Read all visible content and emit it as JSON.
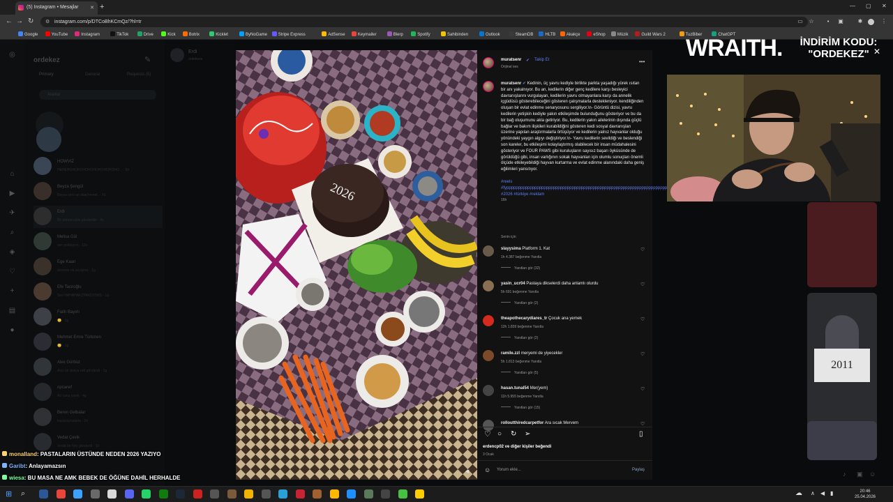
{
  "browser": {
    "tab_title": "(5) Instagram • Mesajlar",
    "url": "instagram.com/p/DTCoBhKCmQz/?hl=tr",
    "bookmarks": [
      "Google",
      "YouTube",
      "Instagram",
      "TikTok",
      "Drive",
      "Kick",
      "Botrix",
      "Kicklet",
      "ByNoGame",
      "Stripe Express",
      "AdSense",
      "Keymailer",
      "Blerp",
      "Spotify",
      "Sahibinden",
      "Outlook",
      "SteamDB",
      "HLTB",
      "Akakçe",
      "eShop",
      "Müzik",
      "Guild Wars 2",
      "TuzBiber",
      "ChatGPT"
    ]
  },
  "inbox": {
    "username": "ordekez",
    "tabs": [
      "Primary",
      "General",
      "Requests (6)"
    ],
    "search_placeholder": "Arama",
    "conversations": [
      {
        "name": "HOWVIZ",
        "msg": "HEHEHOHOHOHOHOHOHOHOHOHO... · 3d"
      },
      {
        "name": "Beyza Şengül",
        "msg": "Beyza sent an attachment. · 7d"
      },
      {
        "name": "Erdi",
        "msg": "Bir dönem ekle gönderdin · 4s"
      },
      {
        "name": "Melisa Gül",
        "msg": "sen yoldaşsın · 13s"
      },
      {
        "name": "Ege Kaan",
        "msg": "anneniz ne sevişiniz · 1g"
      },
      {
        "name": "Efe Taciroğlu",
        "msg": "Sen HAHAHAKZPAKDJSMS · 1g"
      },
      {
        "name": "Fatih Bayırlı",
        "msg": "😊 · 1g"
      },
      {
        "name": "Mehmet Emre Türkmen",
        "msg": "😊 · 1g"
      },
      {
        "name": "Alex Gürbüz",
        "msg": "Alex bir dosya ekli gönderdi · 1g"
      },
      {
        "name": "npcarwf",
        "msg": "Ah cana yanık · 4g"
      },
      {
        "name": "Beren Gelbalar",
        "msg": "kapanışmalarla · 1h"
      },
      {
        "name": "Vedat Çevik",
        "msg": "Vedat bir foto gönderdi · 1h"
      }
    ],
    "chat_header": "Erdi",
    "chat_sub": "ordekeze"
  },
  "post": {
    "author": "muratsenr",
    "follow": "Takip Et",
    "audio": "Orijinal ses",
    "caption": "Kedinin, üç yavru kediyle birlikte parkta yaşadığı yürek ısıtan bir anı yakalnıyor. Bu an, kedilerin diğer genç kedilere karşı besleyici davranışlarını vurgulayan, kedilerin yavru olmayanlara karşı da annelik içgüdüsü gösterebileceğini gösteren çalışmalarla destekleniyor. kendiliğinden oluşan bir evlat edinme senaryosunu sergiliyor.\\n- Görüntü dizisi, yavru kedilerin yetişkin kediyle yakın etkileşimde bulunduğunu gösteriyor ve bu da bir bağ oluşumunu akla getiriyor. Bu, kedilerin yakın ailelerinin dışında güçlü bağlar ve bakım ilişkileri kurabildiğini gösteren kedi sosyal davranışları üzerine yapılan araştırmalarla örtüşüyor ve kedilerin yalnız hayvanlar olduğu yönündeki yaygın algıyı değiştiriyor.\\n- Yavru kedilerin sevildiği ve beslendiği son kareler, bu etkileşimi kolaylaştırmış olabilecek bir insan müdahalesini gösteriyor ve FOUR PAWS gibi kuruluşların sayısız başarı öyküsünde de görüldüğü gibi, insan varlığının sokak hayvanları için olumlu sonuçları önemli ölçüde etkileyebildiği hayvan kurtarma ve evlat edinme alanındaki daha geniş eğilimleri yansıtıyor.",
    "hashtags": "#reels #fyppppppppppppppppppppppppppppppppppppppppppppppppppppppppppppppppppppppppppppp #2026 #türkiye #reklam",
    "time": "16h",
    "for_you": "Senin için",
    "comments": [
      {
        "user": "slayysima",
        "text": "Platform 1. Kat",
        "meta": "1h   4.387 beğenme   Yanıtla",
        "replies": "Yanıtları gör (32)"
      },
      {
        "user": "yasin_ucr04",
        "text": "Pastaya dikselerdi daha anlamlı olurdu",
        "meta": "5h   691 beğenme   Yanıtla",
        "replies": "Yanıtları gör (2)"
      },
      {
        "user": "theapothecarydiares_tr",
        "text": "Çocuk ana yemek",
        "meta": "12h   1.839 beğenme   Yanıtla",
        "replies": "Yanıtları gör (2)"
      },
      {
        "user": "ramile.zzl",
        "text": "meryemi de yiyecekler",
        "meta": "5h   1.813 beğenme   Yanıtla",
        "replies": "Yanıtları gör (5)"
      },
      {
        "user": "hasan.tunal54",
        "text": "Mer(yem)",
        "meta": "11h   5.955 beğenme   Yanıtla",
        "replies": "Yanıtları gör (15)"
      },
      {
        "user": "rolloutthiredcarpetfor",
        "text": "Ara sıcak Mervem",
        "meta": "",
        "replies": ""
      }
    ],
    "likes_text": "erdencp02 ve diğer kişiler beğendi",
    "date": "3 Ocak",
    "comment_placeholder": "Yorum ekle...",
    "share_label": "Paylaş"
  },
  "overlay": {
    "brand": "WRAITH.",
    "discount_line1": "İNDİRİM KODU:",
    "discount_line2": "\"ORDEKEZ\"",
    "sugg_text": "2011"
  },
  "chat": [
    {
      "user": "monalland",
      "text": ": PASTALARIN ÜSTÜNDE NEDEN 2026 YAZIYO",
      "color": "#ffd36b"
    },
    {
      "user": "Garibt",
      "text": ": Anlayamazsın",
      "color": "#7fb4ff"
    },
    {
      "user": "wiesa",
      "text": ": BU MASA NE AMK BEBEK DE ÖĞÜNE DAHİL HERHALDE",
      "color": "#7fff9f"
    }
  ],
  "taskbar": {
    "time": "20:46",
    "date": "25.04.2026"
  },
  "icons": [
    "instagram-icon",
    "home-icon",
    "reels-icon",
    "messenger-icon",
    "search-icon",
    "explore-icon",
    "heart-icon",
    "create-icon",
    "more-icon",
    "like-icon",
    "comment-icon",
    "repost-icon",
    "share-icon",
    "save-icon",
    "emoji-icon"
  ]
}
